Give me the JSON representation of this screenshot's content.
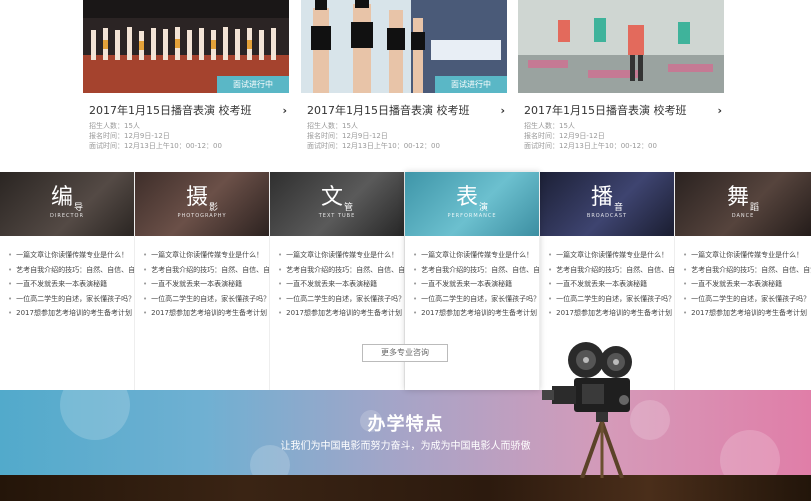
{
  "cards": [
    {
      "status": "面试进行中",
      "title": "2017年1月15日播音表演 校考班",
      "students": "招生人数：15人",
      "reg_time": "报名时间：12月9日-12日",
      "interview_time": "面试时间：12月13日上午10：00-12：00"
    },
    {
      "status": "面试进行中",
      "title": "2017年1月15日播音表演 校考班",
      "students": "招生人数：15人",
      "reg_time": "报名时间：12月9日-12日",
      "interview_time": "面试时间：12月13日上午10：00-12：00"
    },
    {
      "status": "",
      "title": "2017年1月15日播音表演 校考班",
      "students": "招生人数：15人",
      "reg_time": "报名时间：12月9日-12日",
      "interview_time": "面试时间：12月13日上午10：00-12：00"
    }
  ],
  "majors": [
    {
      "big": "编",
      "small": "导",
      "en": "DIRECTOR",
      "color": "#3a3430",
      "items": [
        "一篇文章让你读懂传媒专业是什么！",
        "艺考自我介绍的技巧：自然、自信、自觉",
        "一直不发就丢来一本表演秘籍",
        "一位高二学生的自述，家长懂孩子吗？",
        "2017想参加艺考培训的考生备考计划"
      ]
    },
    {
      "big": "摄",
      "small": "影",
      "en": "PHOTOGRAPHY",
      "color": "#4a3a35",
      "items": [
        "一篇文章让你读懂传媒专业是什么！",
        "艺考自我介绍的技巧：自然、自信、自觉",
        "一直不发就丢来一本表演秘籍",
        "一位高二学生的自述，家长懂孩子吗？",
        "2017想参加艺考培训的考生备考计划"
      ]
    },
    {
      "big": "文",
      "small": "管",
      "en": "TEXT TUBE",
      "color": "#3c3c3c",
      "items": [
        "一篇文章让你读懂传媒专业是什么！",
        "艺考自我介绍的技巧：自然、自信、自觉",
        "一直不发就丢来一本表演秘籍",
        "一位高二学生的自述，家长懂孩子吗？",
        "2017想参加艺考培训的考生备考计划"
      ]
    },
    {
      "big": "表",
      "small": "演",
      "en": "PERFORMANCE",
      "color": "#4fa7b8",
      "items": [
        "一篇文章让你读懂传媒专业是什么！",
        "艺考自我介绍的技巧：自然、自信、自觉",
        "一直不发就丢来一本表演秘籍",
        "一位高二学生的自述，家长懂孩子吗？",
        "2017想参加艺考培训的考生备考计划"
      ]
    },
    {
      "big": "播",
      "small": "音",
      "en": "BROADCAST",
      "color": "#2a2f4a",
      "items": [
        "一篇文章让你读懂传媒专业是什么！",
        "艺考自我介绍的技巧：自然、自信、自觉",
        "一直不发就丢来一本表演秘籍",
        "一位高二学生的自述，家长懂孩子吗？",
        "2017想参加艺考培训的考生备考计划"
      ]
    },
    {
      "big": "舞",
      "small": "蹈",
      "en": "DANCE",
      "color": "#3a302c",
      "items": [
        "一篇文章让你读懂传媒专业是什么！",
        "艺考自我介绍的技巧：自然、自信、自觉",
        "一直不发就丢来一本表演秘籍",
        "一位高二学生的自述，家长懂孩子吗？",
        "2017想参加艺考培训的考生备考计划"
      ]
    }
  ],
  "more_button": "更多专业咨询",
  "features": {
    "title": "办学特点",
    "subtitle": "让我们为中国电影而努力奋斗，为成为中国电影人而骄傲"
  }
}
